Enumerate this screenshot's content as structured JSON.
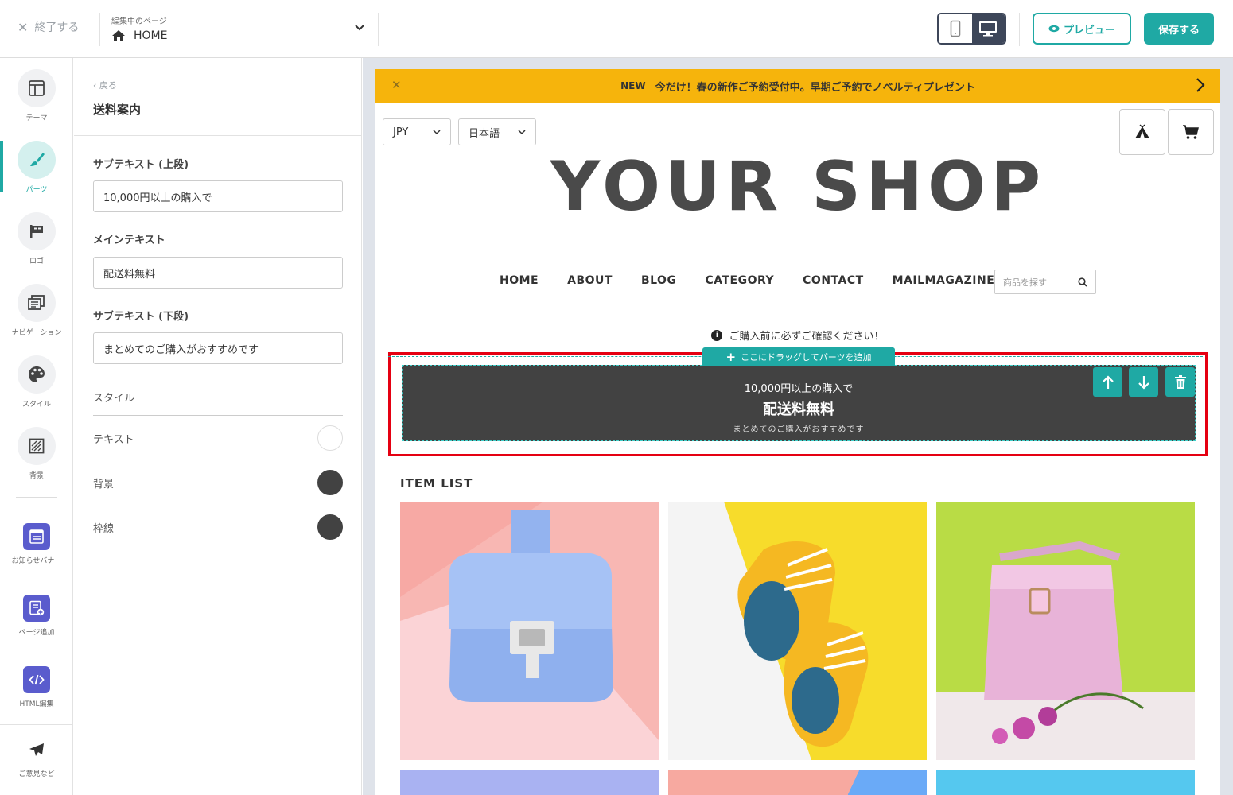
{
  "topbar": {
    "exit_label": "終了する",
    "page_caption": "編集中のページ",
    "page_value": "HOME",
    "preview_label": "プレビュー",
    "save_label": "保存する"
  },
  "rail": {
    "items": [
      {
        "label": "テーマ",
        "icon": "layout-icon"
      },
      {
        "label": "パーツ",
        "icon": "brush-icon"
      },
      {
        "label": "ロゴ",
        "icon": "flag-icon"
      },
      {
        "label": "ナビゲーション",
        "icon": "navigation-icon"
      },
      {
        "label": "スタイル",
        "icon": "palette-icon"
      },
      {
        "label": "背景",
        "icon": "pattern-icon"
      },
      {
        "label": "お知らせバナー",
        "icon": "banner-icon"
      },
      {
        "label": "ページ追加",
        "icon": "add-page-icon"
      },
      {
        "label": "HTML編集",
        "icon": "code-icon"
      }
    ],
    "feedback_label": "ご意見など"
  },
  "panel": {
    "back_label": "戻る",
    "title": "送料案内",
    "fields": [
      {
        "label": "サブテキスト (上段)",
        "value": "10,000円以上の購入で"
      },
      {
        "label": "メインテキスト",
        "value": "配送料無料"
      },
      {
        "label": "サブテキスト (下段)",
        "value": "まとめてのご購入がおすすめです"
      }
    ],
    "style_label": "スタイル",
    "colors": [
      {
        "label": "テキスト",
        "color": "#ffffff"
      },
      {
        "label": "背景",
        "color": "#424242"
      },
      {
        "label": "枠線",
        "color": "#424242"
      }
    ]
  },
  "site": {
    "announce_new": "NEW",
    "announce_text": "今だけ！春の新作ご予約受付中。早期ご予約でノベルティプレゼント",
    "currency": "JPY",
    "language": "日本語",
    "logo_text": "YOUR SHOP",
    "nav": [
      "HOME",
      "ABOUT",
      "BLOG",
      "CATEGORY",
      "CONTACT",
      "MAILMAGAZINE"
    ],
    "search_placeholder": "商品を探す",
    "notice_text": "ご購入前に必ずご確認ください！",
    "drop_text": "ここにドラッグしてパーツを追加",
    "shipping": {
      "sub_top": "10,000円以上の購入で",
      "main": "配送料無料",
      "sub_bottom": "まとめてのご購入がおすすめです"
    },
    "item_list_title": "ITEM LIST"
  },
  "colors": {
    "accent": "#1fa9a4",
    "announce_bg": "#f6b40c",
    "selection": "#e50012",
    "banner_bg": "#424242"
  }
}
